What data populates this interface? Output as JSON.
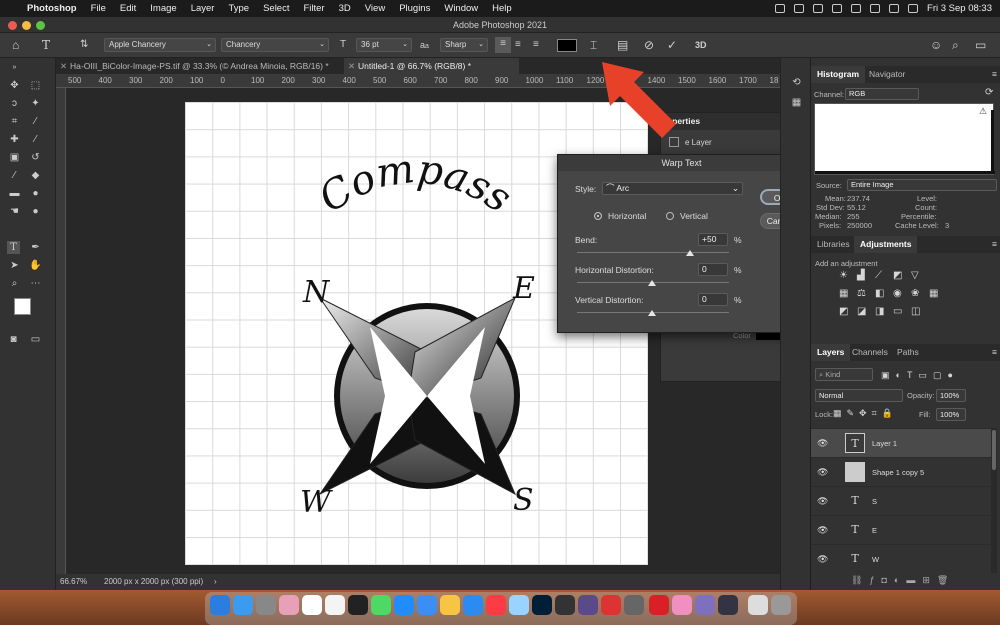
{
  "menubar": {
    "app_name": "Photoshop",
    "items": [
      "File",
      "Edit",
      "Image",
      "Layer",
      "Type",
      "Select",
      "Filter",
      "3D",
      "View",
      "Plugins",
      "Window",
      "Help"
    ],
    "clock": "Fri 3 Sep  08:33"
  },
  "window": {
    "title": "Adobe Photoshop 2021"
  },
  "options": {
    "font_family": "Apple Chancery",
    "font_style": "Chancery",
    "font_size": "36 pt",
    "aa_label": "a",
    "antialias": "Sharp",
    "swatch_color": "#000000",
    "threed_label": "3D"
  },
  "tabs": [
    {
      "label": "Ha-OIII_BiColor-Image-PS.tif @ 33.3% (© Andrea Minoia, RGB/16) *",
      "active": false
    },
    {
      "label": "Untitled-1 @ 66.7% (RGB/8) *",
      "active": true
    }
  ],
  "ruler": {
    "ticks": [
      "500",
      "400",
      "300",
      "200",
      "100",
      "0",
      "100",
      "200",
      "300",
      "400",
      "500",
      "600",
      "700",
      "800",
      "900",
      "1000",
      "1100",
      "1200",
      "1300",
      "1400",
      "1500",
      "1600",
      "1700",
      "18"
    ]
  },
  "status": {
    "zoom": "66.67%",
    "doc_info": "2000 px x 2000 px (300 ppi)",
    "arrow": "›"
  },
  "artwork": {
    "title": "Compass",
    "north": "N",
    "east": "E",
    "south": "S",
    "west": "W"
  },
  "properties": {
    "tab_label": "operties",
    "layer_label": "e Layer",
    "color_label": "Color"
  },
  "warp": {
    "title": "Warp Text",
    "style_label": "Style:",
    "style_value": "Arc",
    "horizontal_label": "Horizontal",
    "vertical_label": "Vertical",
    "orientation_selected": "Horizontal",
    "bend_label": "Bend:",
    "bend_value": "+50",
    "hdist_label": "Horizontal Distortion:",
    "hdist_value": "0",
    "vdist_label": "Vertical Distortion:",
    "vdist_value": "0",
    "pct": "%",
    "ok_label": "OK",
    "cancel_label": "Cancel",
    "bend": 50,
    "hdist": 0,
    "vdist": 0
  },
  "histogram": {
    "tabs": [
      "Histogram",
      "Navigator"
    ],
    "channel_label": "Channel:",
    "channel_value": "RGB",
    "source_label": "Source:",
    "source_value": "Entire Image",
    "mean_label": "Mean:",
    "mean": "237.74",
    "stddev_label": "Std Dev:",
    "stddev": "55.12",
    "median_label": "Median:",
    "median": "255",
    "pixels_label": "Pixels:",
    "pixels": "250000",
    "level_label": "Level:",
    "count_label": "Count:",
    "percentile_label": "Percentile:",
    "cache_label": "Cache Level:",
    "cache": "3"
  },
  "adjustments": {
    "tabs": [
      "Libraries",
      "Adjustments"
    ],
    "hint": "Add an adjustment"
  },
  "layers": {
    "tabs": [
      "Layers",
      "Channels",
      "Paths"
    ],
    "search": "Kind",
    "blend": "Normal",
    "opacity_label": "Opacity:",
    "opacity": "100%",
    "lock_label": "Lock:",
    "fill_label": "Fill:",
    "fill": "100%",
    "items": [
      {
        "name": "Layer 1",
        "thumb": "T"
      },
      {
        "name": "Shape 1 copy 5",
        "thumb": ""
      },
      {
        "name": "S",
        "thumb": "T"
      },
      {
        "name": "E",
        "thumb": "T"
      },
      {
        "name": "W",
        "thumb": "T"
      }
    ],
    "footer_icons": [
      "link-icon",
      "fx-icon",
      "mask-icon",
      "adjustment-icon",
      "folder-icon",
      "new-layer-icon",
      "trash-icon"
    ]
  },
  "colors": {
    "accent_arrow": "#e8412a",
    "canvas_bg": "#ffffff",
    "panel_bg": "#323232",
    "foreground": "#ffffff",
    "background": "#1c2a8c"
  }
}
